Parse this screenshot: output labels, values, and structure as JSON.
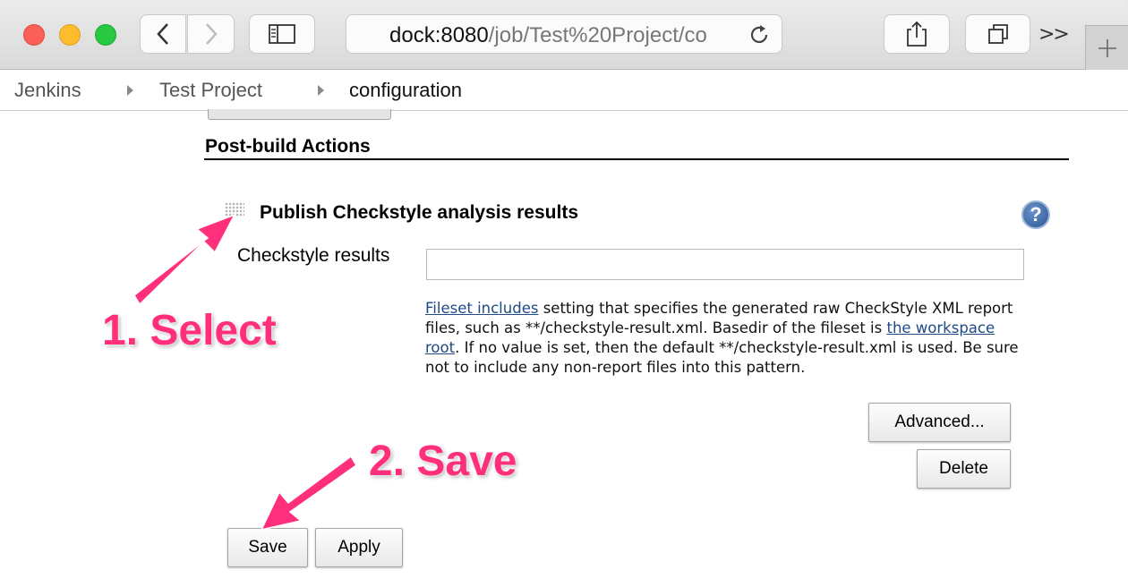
{
  "browser": {
    "url_host": "dock:8080",
    "url_path": "/job/Test%20Project/co",
    "icons": [
      "back-icon",
      "forward-icon",
      "sidebar-icon",
      "reload-icon",
      "share-icon",
      "tabs-icon",
      "overflow-icon",
      "new-tab-icon"
    ]
  },
  "breadcrumb": {
    "items": [
      "Jenkins",
      "Test Project",
      "configuration"
    ]
  },
  "post_build": {
    "section_title": "Post-build Actions",
    "step_title": "Publish Checkstyle analysis results",
    "help_icon_label": "?",
    "field_label": "Checkstyle results",
    "field_value": "",
    "help": {
      "link1": "Fileset includes",
      "text1": " setting that specifies the generated raw CheckStyle XML report files, such as **/checkstyle-result.xml. Basedir of the fileset is ",
      "link2": "the workspace root",
      "text2": ". If no value is set, then the default **/checkstyle-result.xml is used. Be sure not to include any non-report files into this pattern."
    },
    "advanced_label": "Advanced...",
    "delete_label": "Delete"
  },
  "form": {
    "save_label": "Save",
    "apply_label": "Apply"
  },
  "annotations": {
    "step1": "1. Select",
    "step2": "2. Save",
    "color": "#ff2f7b"
  }
}
